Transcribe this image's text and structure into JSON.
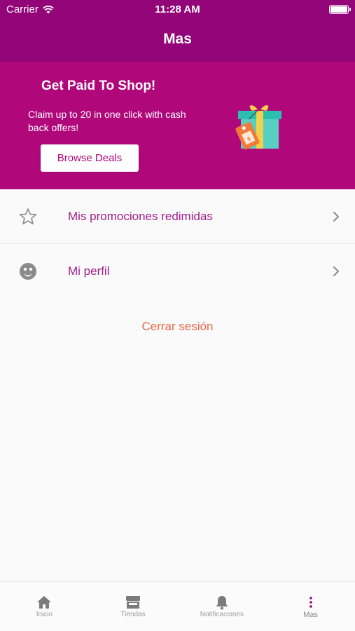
{
  "status": {
    "carrier": "Carrier",
    "time": "11:28 AM"
  },
  "nav": {
    "title": "Mas"
  },
  "promo": {
    "title": "Get Paid To Shop!",
    "description": "Claim up to 20 in one click with cash back offers!",
    "button_label": "Browse Deals"
  },
  "menu": {
    "items": [
      {
        "label": "Mis promociones redimidas",
        "icon": "star-icon"
      },
      {
        "label": "Mi perfil",
        "icon": "profile-face-icon"
      }
    ]
  },
  "logout": {
    "label": "Cerrar sesión"
  },
  "tabs": [
    {
      "label": "Inicio",
      "icon": "home-icon"
    },
    {
      "label": "Tiendas",
      "icon": "store-icon"
    },
    {
      "label": "Notificaciones",
      "icon": "bell-icon"
    },
    {
      "label": "Mas",
      "icon": "more-vertical-icon",
      "active": true
    }
  ],
  "colors": {
    "header": "#920478",
    "promo": "#b0077b",
    "accent_text": "#a21c8b",
    "logout": "#e8674a"
  }
}
